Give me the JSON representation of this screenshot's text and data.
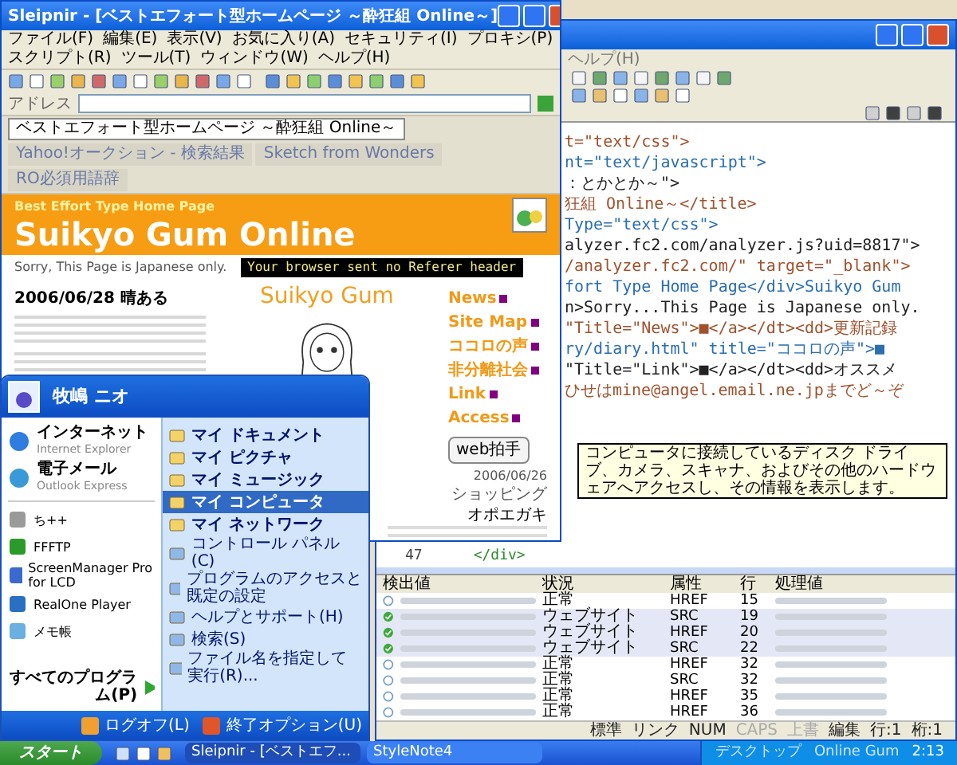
{
  "browser": {
    "title": "Sleipnir - [ベストエフォート型ホームページ ～酔狂組 Online～]",
    "menu": [
      "ファイル(F)",
      "編集(E)",
      "表示(V)",
      "お気に入り(A)",
      "セキュリティ(I)",
      "プロキシ(P)",
      "スクリプト(R)",
      "ツール(T)",
      "ウィンドウ(W)",
      "ヘルプ(H)"
    ],
    "address_label": "アドレス",
    "tabs": [
      {
        "label": "ベストエフォート型ホームページ ～酔狂組 Online～",
        "selected": true
      },
      {
        "label": "Yahoo!オークション - 検索結果",
        "selected": false
      },
      {
        "label": "Sketch from Wonders",
        "selected": false
      },
      {
        "label": "RO必須用語辞",
        "selected": false
      }
    ],
    "page": {
      "header_subtitle": "Best Effort Type Home Page",
      "header_title": "Suikyo Gum Online",
      "notice": "Sorry, This Page is Japanese only.",
      "tooltip": "Your browser sent no Referer header",
      "date": "2006/06/28 晴ある",
      "logo": "Suikyo Gum",
      "caption_date": "2006/06/26",
      "caption": "ショッピング",
      "sidebar": [
        "News",
        "Site Map",
        "ココロの声",
        "非分離社会",
        "Link",
        "Access"
      ],
      "clap_button": "web拍手",
      "section_title": "オポエガキ"
    }
  },
  "editor": {
    "menu": [
      "ヘルプ(H)"
    ],
    "code_lines": [
      "t=\"text/css\">",
      "nt=\"text/javascript\">",
      "：とかとか～\">",
      "狂組 Online～</title>",
      "Type=\"text/css\">",
      "alyzer.fc2.com/analyzer.js?uid=8817\">",
      "/analyzer.fc2.com/\" target=\"_blank\">",
      "fort Type Home Page</div>Suikyo Gum",
      "n>Sorry...This Page is Japanese only.",
      "\"Title=\"News\">■</a></dt><dd>更新記録",
      "ry/diary.html\" title=\"ココロの声\">■",
      "\"Title=\"Link\">■</a></dt><dd>オススメ",
      "ひせはmine@angel.email.ne.jpまでど～ぞ"
    ],
    "line_number": "47",
    "bottom_line": "</div>",
    "table": {
      "columns": [
        "検出値",
        "状況",
        "属性",
        "行",
        "処理値"
      ],
      "rows": [
        {
          "checked": false,
          "selected": false,
          "status": "正常",
          "attribute": "HREF",
          "line": "15"
        },
        {
          "checked": true,
          "selected": true,
          "status": "ウェブサイト",
          "attribute": "SRC",
          "line": "19"
        },
        {
          "checked": true,
          "selected": true,
          "status": "ウェブサイト",
          "attribute": "HREF",
          "line": "20"
        },
        {
          "checked": true,
          "selected": true,
          "status": "ウェブサイト",
          "attribute": "SRC",
          "line": "22"
        },
        {
          "checked": false,
          "selected": false,
          "status": "正常",
          "attribute": "HREF",
          "line": "32"
        },
        {
          "checked": false,
          "selected": false,
          "status": "正常",
          "attribute": "SRC",
          "line": "32"
        },
        {
          "checked": false,
          "selected": false,
          "status": "正常",
          "attribute": "HREF",
          "line": "35"
        },
        {
          "checked": false,
          "selected": false,
          "status": "正常",
          "attribute": "HREF",
          "line": "36"
        }
      ]
    },
    "status_bar": [
      {
        "text": "標準",
        "disabled": false
      },
      {
        "text": "リンク",
        "disabled": false
      },
      {
        "text": "NUM",
        "disabled": false
      },
      {
        "text": "CAPS",
        "disabled": true
      },
      {
        "text": "上書",
        "disabled": true
      },
      {
        "text": "編集",
        "disabled": false
      },
      {
        "text": "行:1",
        "disabled": false
      },
      {
        "text": "桁:1",
        "disabled": false
      }
    ]
  },
  "start_menu": {
    "user": "牧嶋 ニオ",
    "pinned": [
      {
        "title": "インターネット",
        "subtitle": "Internet Explorer"
      },
      {
        "title": "電子メール",
        "subtitle": "Outlook Express"
      }
    ],
    "recent": [
      "ち++",
      "FFFTP",
      "ScreenManager Pro for LCD",
      "RealOne Player",
      "メモ帳"
    ],
    "all_programs": "すべてのプログラム(P)",
    "places": [
      {
        "label": "マイ ドキュメント",
        "kind": "primary",
        "selected": false
      },
      {
        "label": "マイ ピクチャ",
        "kind": "primary",
        "selected": false
      },
      {
        "label": "マイ ミュージック",
        "kind": "primary",
        "selected": false
      },
      {
        "label": "マイ コンピュータ",
        "kind": "primary",
        "selected": true
      },
      {
        "label": "マイ ネットワーク",
        "kind": "primary",
        "selected": false
      },
      {
        "label": "コントロール パネル(C)",
        "kind": "secondary",
        "selected": false
      },
      {
        "label": "プログラムのアクセスと既定の設定",
        "kind": "secondary",
        "selected": false
      },
      {
        "label": "ヘルプとサポート(H)",
        "kind": "secondary",
        "selected": false
      },
      {
        "label": "検索(S)",
        "kind": "secondary",
        "selected": false
      },
      {
        "label": "ファイル名を指定して実行(R)...",
        "kind": "secondary",
        "selected": false
      }
    ],
    "logoff": "ログオフ(L)",
    "shutdown": "終了オプション(U)",
    "tooltip": "コンピュータに接続しているディスク ドライブ、カメラ、スキャナ、およびその他のハードウェアへアクセスし、その情報を表示します。"
  },
  "taskbar": {
    "start": "スタート",
    "tasks": [
      {
        "label": "Sleipnir - [ベストエフ...",
        "selected": true
      },
      {
        "label": "StyleNote4",
        "selected": false
      }
    ],
    "tray": [
      "デスクトップ",
      "Online Gum"
    ],
    "clock": "2:13"
  }
}
